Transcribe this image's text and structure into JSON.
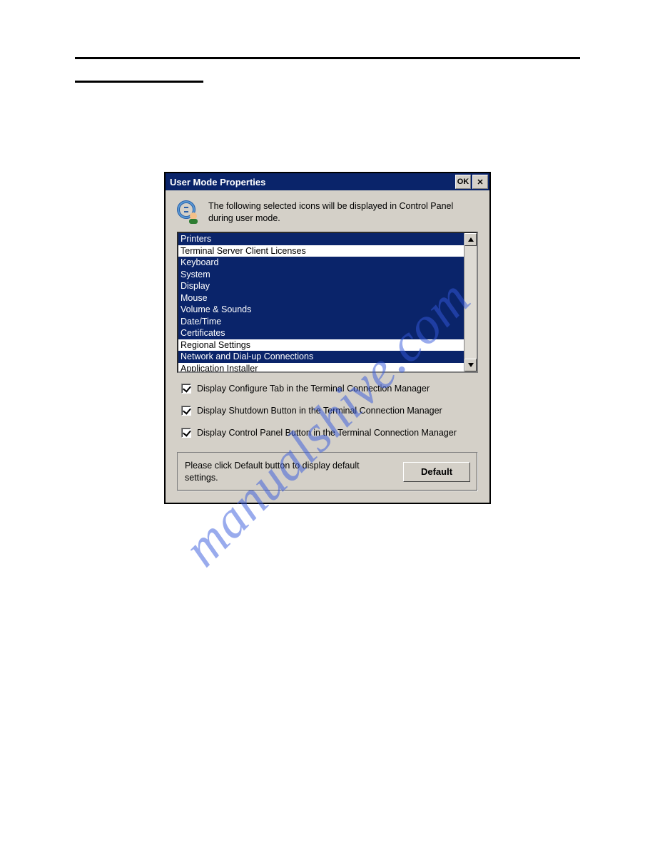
{
  "watermark": "manualshive.com",
  "dialog": {
    "title": "User Mode Properties",
    "ok_label": "OK",
    "close_label": "✕",
    "intro": "The following selected icons will be displayed in Control Panel during user mode.",
    "list": [
      {
        "label": "Printers",
        "selected": true
      },
      {
        "label": "Terminal Server Client Licenses",
        "selected": false
      },
      {
        "label": "Keyboard",
        "selected": true
      },
      {
        "label": "System",
        "selected": true
      },
      {
        "label": "Display",
        "selected": true
      },
      {
        "label": "Mouse",
        "selected": true
      },
      {
        "label": "Volume & Sounds",
        "selected": true
      },
      {
        "label": "Date/Time",
        "selected": true
      },
      {
        "label": "Certificates",
        "selected": true
      },
      {
        "label": "Regional Settings",
        "selected": false
      },
      {
        "label": "Network and Dial-up Connections",
        "selected": true
      },
      {
        "label": "Application Installer",
        "selected": false
      }
    ],
    "checks": [
      {
        "label": "Display Configure Tab in the Terminal Connection Manager",
        "checked": true
      },
      {
        "label": "Display Shutdown Button in the Terminal Connection Manager",
        "checked": true
      },
      {
        "label": "Display Control Panel Button in the Terminal Connection Manager",
        "checked": true
      }
    ],
    "default_hint": "Please click Default button to display default settings.",
    "default_button": "Default"
  }
}
